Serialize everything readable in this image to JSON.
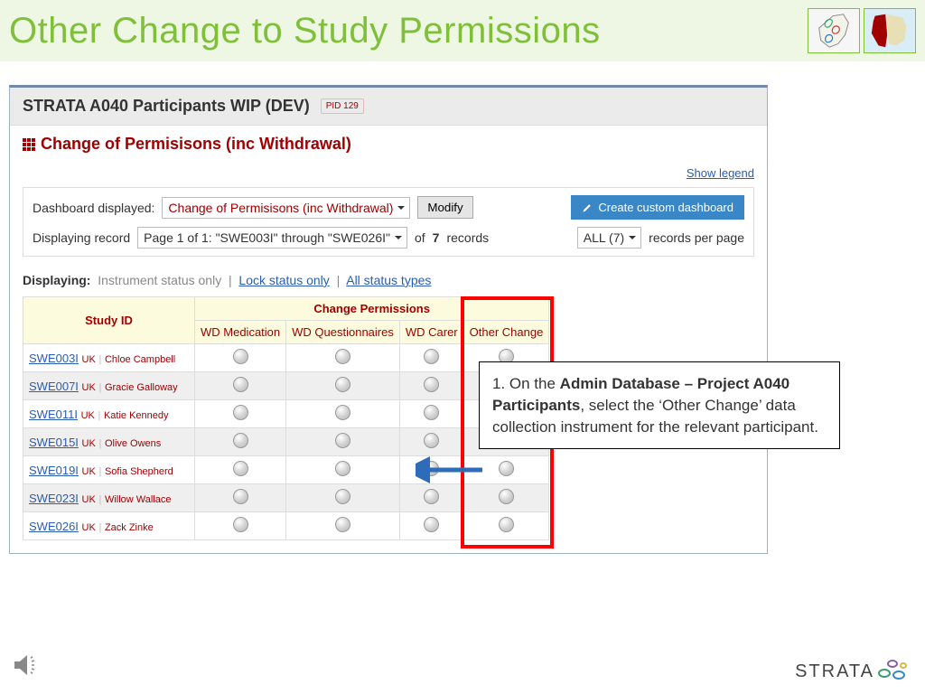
{
  "page_title": "Other Change to Study Permissions",
  "app": {
    "title": "STRATA A040 Participants WIP (DEV)",
    "pid_badge": "PID  129",
    "section_title": "Change of Permisisons (inc Withdrawal)",
    "show_legend": "Show legend"
  },
  "dashboard": {
    "displayed_label": "Dashboard displayed:",
    "displayed_value": "Change of Permisisons (inc Withdrawal)",
    "modify": "Modify",
    "create_custom": "Create custom dashboard",
    "record_label": "Displaying record",
    "page_value": "Page 1 of 1: \"SWE003I\" through \"SWE026I\"",
    "of_text": "of",
    "total": "7",
    "records_text": "records",
    "rpp_value": "ALL (7)",
    "rpp_text": "records per page"
  },
  "displaying": {
    "label": "Displaying:",
    "opt1": "Instrument status only",
    "opt2": "Lock status only",
    "opt3": "All status types"
  },
  "table": {
    "study_id_header": "Study ID",
    "group_header": "Change Permissions",
    "cols": [
      "WD Medication",
      "WD Questionnaires",
      "WD Carer",
      "Other Change"
    ],
    "rows": [
      {
        "id": "SWE003I",
        "country": "UK",
        "name": "Chloe Campbell"
      },
      {
        "id": "SWE007I",
        "country": "UK",
        "name": "Gracie Galloway"
      },
      {
        "id": "SWE011I",
        "country": "UK",
        "name": "Katie Kennedy"
      },
      {
        "id": "SWE015I",
        "country": "UK",
        "name": "Olive Owens"
      },
      {
        "id": "SWE019I",
        "country": "UK",
        "name": "Sofia Shepherd"
      },
      {
        "id": "SWE023I",
        "country": "UK",
        "name": "Willow Wallace"
      },
      {
        "id": "SWE026I",
        "country": "UK",
        "name": "Zack Zinke"
      }
    ]
  },
  "callout": {
    "num": "1. ",
    "bold": "Admin Database – Project A040 Participants",
    "pre": "On the ",
    "post": ", select the ‘Other Change’ data collection instrument for the relevant participant."
  },
  "footer_logo": "STRATA"
}
